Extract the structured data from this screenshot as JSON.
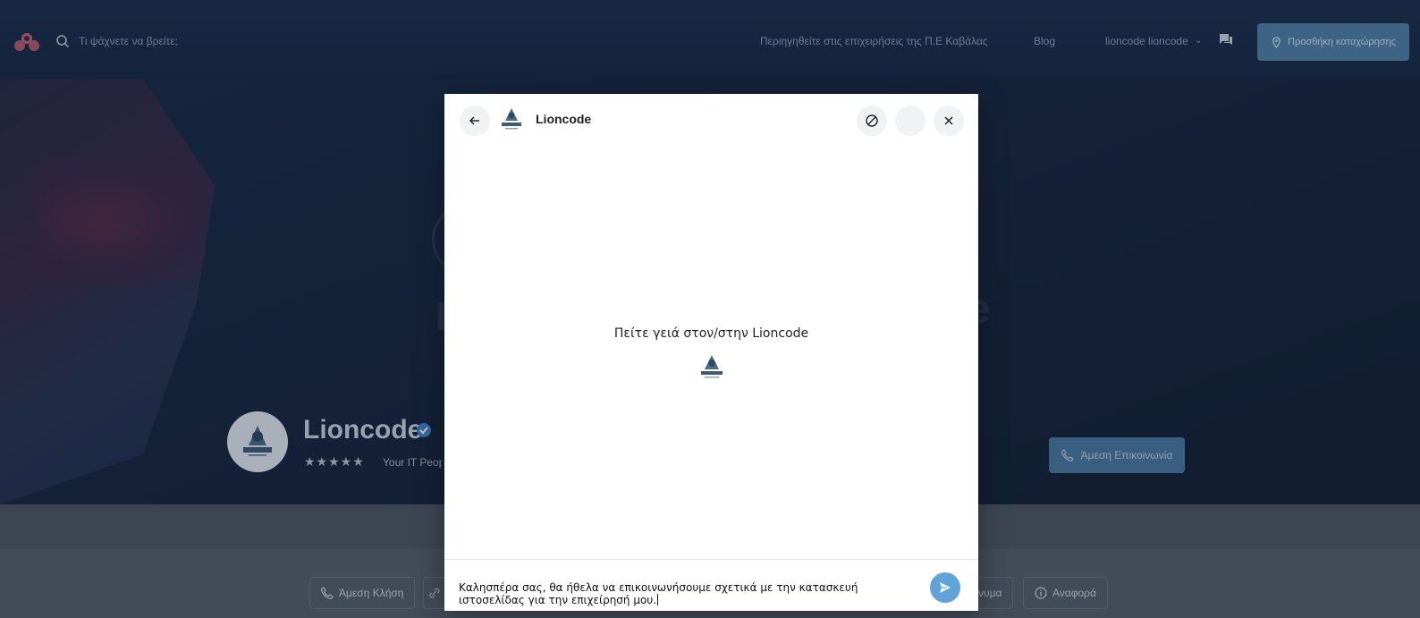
{
  "topbar": {
    "search_placeholder": "Τι ψάχνετε να βρείτε;",
    "nav_browse": "Περιηγηθείτε στις επιχειρήσεις της Π.Ε Καβάλας",
    "nav_blog": "Blog",
    "user_name": "lioncode lioncode",
    "add_listing": "Προσθήκη καταχώρησης"
  },
  "hero": {
    "company_name": "Lioncode",
    "stars": "★★★★★",
    "tagline": "Your IT Peop",
    "contact_button": "Άμεση Επικοινωνία"
  },
  "actions": {
    "call": "Άμεση Κλήση",
    "message_partial": "νυμα",
    "report": "Αναφορά"
  },
  "chat": {
    "title": "Lioncode",
    "greeting": "Πείτε γειά στον/στην Lioncode",
    "message_input": "Καλησπέρα σας, θα ήθελα να επικοινωνήσουμε σχετικά με την κατασκευή ιστοσελίδας για την επιχείρησή μου."
  },
  "colors": {
    "send_button": "#5fa3d9",
    "overlay_bg": "#1c2c45",
    "accent_button": "#4f80a9"
  },
  "icons": {
    "back": "arrow-left-icon",
    "block": "block-icon",
    "close": "close-icon",
    "send": "send-icon",
    "search": "search-icon",
    "chat": "chat-icon",
    "phone": "phone-icon",
    "info": "info-icon",
    "location": "location-pin-icon"
  }
}
